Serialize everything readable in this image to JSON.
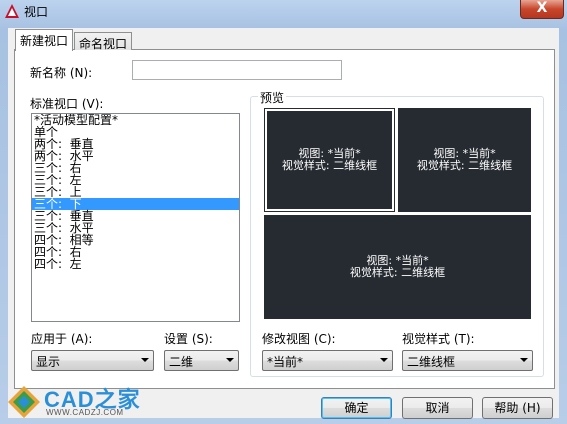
{
  "window": {
    "title": "视口",
    "close_label": "X",
    "colors": {
      "selection": "#3399ff",
      "preview_bg": "#262b32",
      "close": "#c7462c"
    }
  },
  "tabs": [
    {
      "label": "新建视口",
      "active": true
    },
    {
      "label": "命名视口",
      "active": false
    }
  ],
  "new_name": {
    "label": "新名称 (N):",
    "value": ""
  },
  "standard_viewports": {
    "label": "标准视口 (V):",
    "items": [
      "*活动模型配置*",
      "单个",
      "两个:  垂直",
      "两个:  水平",
      "三个:  右",
      "三个:  左",
      "三个:  上",
      "三个:  下",
      "三个:  垂直",
      "三个:  水平",
      "四个:  相等",
      "四个:  右",
      "四个:  左"
    ],
    "selected_index": 7
  },
  "preview": {
    "label": "预览",
    "viewports": [
      {
        "view": "视图: *当前*",
        "style": "视觉样式: 二维线框"
      },
      {
        "view": "视图: *当前*",
        "style": "视觉样式: 二维线框"
      },
      {
        "view": "视图: *当前*",
        "style": "视觉样式: 二维线框"
      }
    ]
  },
  "apply_to": {
    "label": "应用于 (A):",
    "value": "显示"
  },
  "setup": {
    "label": "设置 (S):",
    "value": "二维"
  },
  "change_view": {
    "label": "修改视图 (C):",
    "value": "*当前*"
  },
  "visual_style": {
    "label": "视觉样式 (T):",
    "value": "二维线框"
  },
  "buttons": {
    "ok": "确定",
    "cancel": "取消",
    "help": "帮助 (H)"
  },
  "watermark": {
    "brand": "CAD之家",
    "url": "WWW.CADZJ.COM"
  }
}
